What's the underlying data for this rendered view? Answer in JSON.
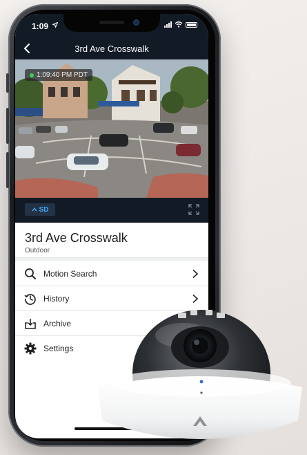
{
  "status_bar": {
    "time": "1:09"
  },
  "nav": {
    "title": "3rd Ave Crosswalk"
  },
  "video": {
    "timestamp": "1:09:40 PM PDT"
  },
  "controls": {
    "quality_label": "SD"
  },
  "camera": {
    "name": "3rd Ave Crosswalk",
    "type": "Outdoor"
  },
  "menu": {
    "items": [
      {
        "label": "Motion Search",
        "icon": "search-icon"
      },
      {
        "label": "History",
        "icon": "history-icon"
      },
      {
        "label": "Archive",
        "icon": "archive-icon"
      },
      {
        "label": "Settings",
        "icon": "gear-icon"
      }
    ]
  },
  "colors": {
    "header_bg": "#121a26",
    "accent": "#3fa9f5",
    "live": "#39d353"
  }
}
